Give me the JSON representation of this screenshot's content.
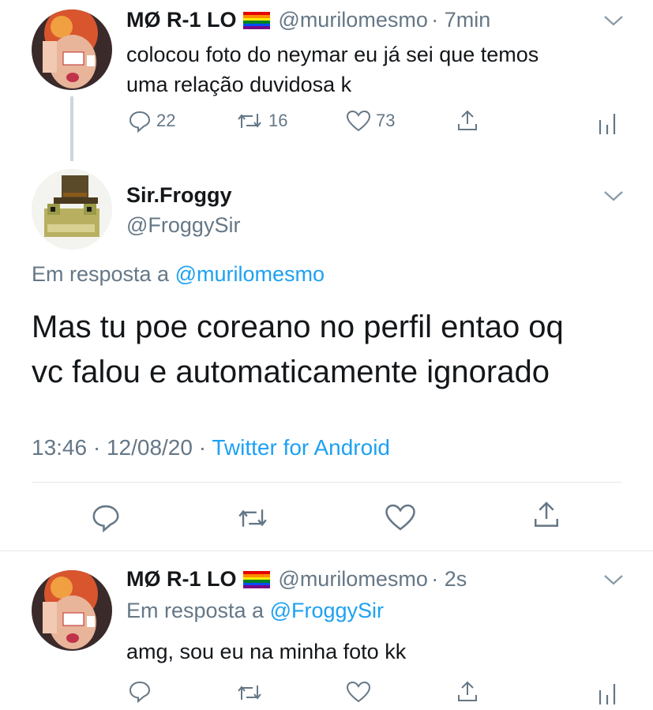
{
  "tweet1": {
    "display_name": "MØ R-1 LO",
    "handle": "@murilomesmo",
    "time": "· 7min",
    "text_line1": "colocou foto do neymar eu já sei que temos",
    "text_line2": "uma relação duvidosa k",
    "replies": "22",
    "retweets": "16",
    "likes": "73"
  },
  "main_tweet": {
    "display_name": "Sir.Froggy",
    "handle": "@FroggySir",
    "reply_prefix": "Em resposta a",
    "reply_to": "@murilomesmo",
    "text_line1": "Mas tu poe coreano no perfil entao oq",
    "text_line2": "vc falou e automaticamente ignorado",
    "timestamp": "13:46 · 12/08/20 ·",
    "source": "Twitter for Android"
  },
  "tweet3": {
    "display_name": "MØ R-1 LO",
    "handle": "@murilomesmo",
    "time": "· 2s",
    "reply_prefix": "Em resposta a",
    "reply_to": "@FroggySir",
    "text": "amg, sou eu na minha foto kk"
  },
  "icons": [
    "reply-icon",
    "retweet-icon",
    "like-icon",
    "share-icon",
    "analytics-icon",
    "chevron-down-icon"
  ],
  "colors": {
    "link": "#1da1f2",
    "muted": "#657786",
    "divider": "#e1e8ed"
  }
}
